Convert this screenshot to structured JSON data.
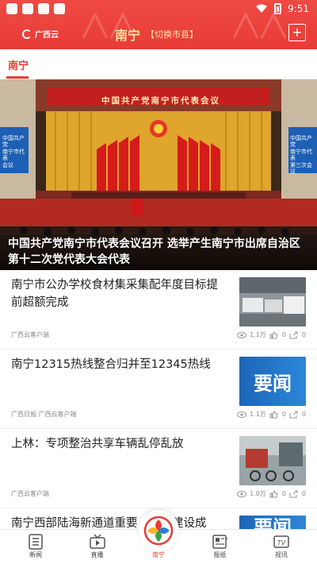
{
  "status_bar": {
    "time": "9:51"
  },
  "header": {
    "logo_text": "广西云",
    "city": "南宁",
    "switch_label": "【切换市县】",
    "add_button": "+"
  },
  "tabs": {
    "active": "南宁"
  },
  "hero": {
    "banner_text": "中国共产党南宁市代表会议",
    "left_screen_text": "中国共产党\n南宁市代表\n会议",
    "right_screen_text": "中国共产党\n南宁市代表\n第三次会议",
    "caption": "中国共产党南宁市代表会议召开 选举产生南宁市出席自治区第十二次党代表大会代表"
  },
  "news": [
    {
      "title": "南宁市公办学校食材集采集配年度目标提前超额完成",
      "source": "广西云客户端",
      "views": "1.1万",
      "likes": "0",
      "shares": "0"
    },
    {
      "title": "南宁12315热线整合归并至12345热线",
      "source": "广西日报·广西云客户端",
      "views": "1.1万",
      "likes": "0",
      "shares": "0",
      "thumb_text": "要闻"
    },
    {
      "title": "上林：专项整治共享车辆乱停乱放",
      "source": "广西云客户端",
      "views": "1.0万",
      "likes": "0",
      "shares": "0"
    },
    {
      "title": "南宁西部陆海新通道重要……市建设成",
      "thumb_text": "要闻"
    }
  ],
  "bottom_nav": [
    {
      "label": "新闻",
      "icon": "news-icon"
    },
    {
      "label": "直播",
      "icon": "live-tv-icon"
    },
    {
      "label": "南宁",
      "icon": "city-emblem-icon",
      "active": true
    },
    {
      "label": "报纸",
      "icon": "newspaper-icon"
    },
    {
      "label": "视讯",
      "icon": "tv-icon"
    }
  ],
  "colors": {
    "brand_red": "#e83b36",
    "title_gold": "#ffe8a0",
    "thumb_blue": "#1d66b8"
  }
}
